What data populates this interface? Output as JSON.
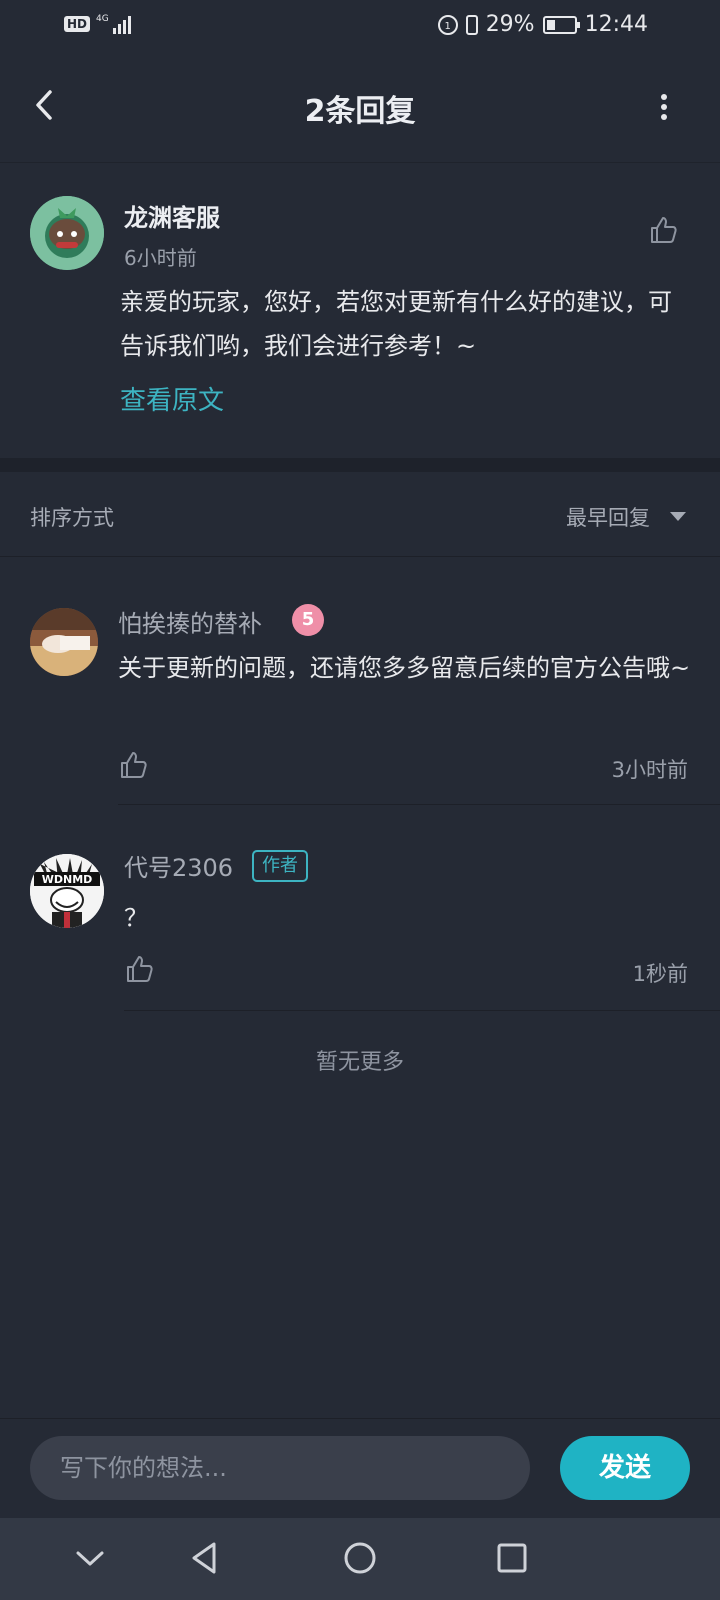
{
  "status_bar": {
    "hd": "HD",
    "network": "4G",
    "battery": "29%",
    "battery_level": 0.29,
    "time": "12:44"
  },
  "header": {
    "title": "2条回复"
  },
  "main_comment": {
    "name": "龙渊客服",
    "time": "6小时前",
    "content": "亲爱的玩家，您好，若您对更新有什么好的建议，可告诉我们哟，我们会进行参考！~",
    "view_original": "查看原文"
  },
  "sort": {
    "label": "排序方式",
    "value": "最早回复"
  },
  "replies": [
    {
      "name": "怕挨揍的替补",
      "level": "5",
      "content": "关于更新的问题，还请您多多留意后续的官方公告哦~",
      "time": "3小时前"
    },
    {
      "name": "代号2306",
      "badge": "作者",
      "avatar_text": "WDNMD",
      "content": "？",
      "time": "1秒前"
    }
  ],
  "no_more": "暂无更多",
  "input": {
    "placeholder": "写下你的想法...",
    "send": "发送"
  },
  "colors": {
    "background": "#252a35",
    "accent": "#1fb3c4",
    "link": "#3db4c2"
  }
}
